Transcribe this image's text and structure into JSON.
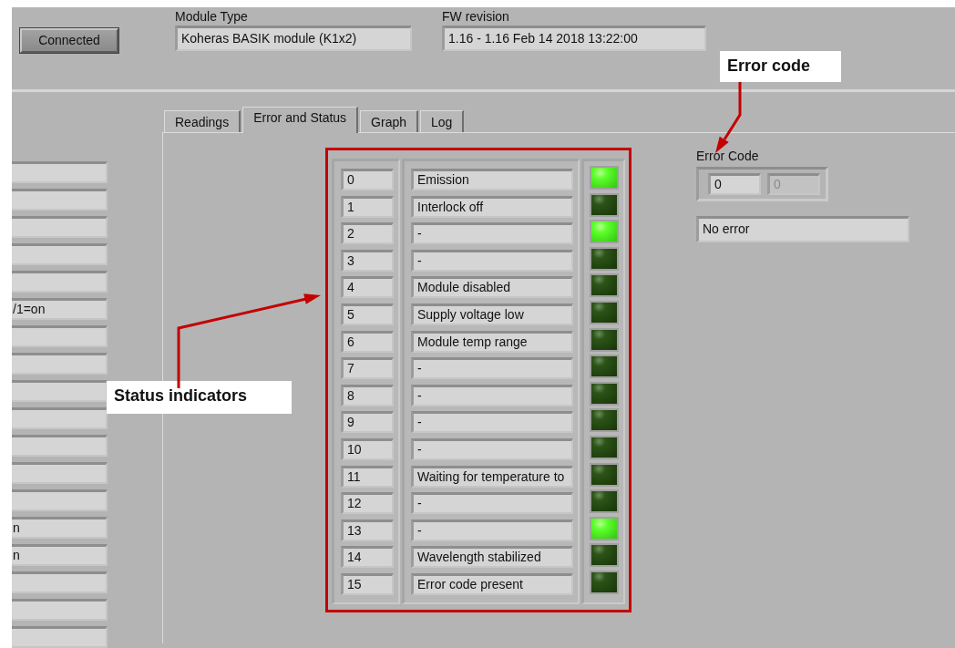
{
  "header": {
    "connect_button": "Connected",
    "module_type": {
      "label": "Module Type",
      "value": "Koheras BASIK module (K1x2)"
    },
    "fw_revision": {
      "label": "FW revision",
      "value": "1.16 - 1.16  Feb 14 2018 13:22:00"
    }
  },
  "left_fields": [
    {
      "kind": "blank"
    },
    {
      "kind": "blank"
    },
    {
      "kind": "blank"
    },
    {
      "kind": "blank"
    },
    {
      "kind": "blank"
    },
    {
      "kind": "text",
      "value": "/1=on"
    },
    {
      "kind": "blank"
    },
    {
      "kind": "blank"
    },
    {
      "kind": "blank"
    },
    {
      "kind": "blank"
    },
    {
      "kind": "blank"
    },
    {
      "kind": "blank"
    },
    {
      "kind": "blank"
    },
    {
      "kind": "text",
      "value": "n"
    },
    {
      "kind": "text",
      "value": "n"
    },
    {
      "kind": "blank"
    },
    {
      "kind": "blank"
    },
    {
      "kind": "blank"
    }
  ],
  "tabs": [
    {
      "label": "Readings",
      "selected": false
    },
    {
      "label": "Error and Status",
      "selected": true
    },
    {
      "label": "Graph",
      "selected": false
    },
    {
      "label": "Log",
      "selected": false
    }
  ],
  "status_indicators": [
    {
      "bit": "0",
      "label": "Emission",
      "on": true
    },
    {
      "bit": "1",
      "label": "Interlock off",
      "on": false
    },
    {
      "bit": "2",
      "label": "-",
      "on": true
    },
    {
      "bit": "3",
      "label": "-",
      "on": false
    },
    {
      "bit": "4",
      "label": "Module disabled",
      "on": false
    },
    {
      "bit": "5",
      "label": "Supply voltage low",
      "on": false
    },
    {
      "bit": "6",
      "label": "Module temp range",
      "on": false
    },
    {
      "bit": "7",
      "label": "-",
      "on": false
    },
    {
      "bit": "8",
      "label": "-",
      "on": false
    },
    {
      "bit": "9",
      "label": "-",
      "on": false
    },
    {
      "bit": "10",
      "label": "-",
      "on": false
    },
    {
      "bit": "11",
      "label": "Waiting for temperature to",
      "on": false
    },
    {
      "bit": "12",
      "label": "-",
      "on": false
    },
    {
      "bit": "13",
      "label": "-",
      "on": true
    },
    {
      "bit": "14",
      "label": "Wavelength stabilized",
      "on": false
    },
    {
      "bit": "15",
      "label": "Error code present",
      "on": false
    }
  ],
  "error": {
    "label": "Error Code",
    "code": {
      "value": "0",
      "disabled": false
    },
    "code_secondary": {
      "value": "0",
      "disabled": true
    },
    "message": "No error"
  },
  "annotations": [
    {
      "text": "Error code"
    },
    {
      "text": "Status indicators"
    }
  ]
}
